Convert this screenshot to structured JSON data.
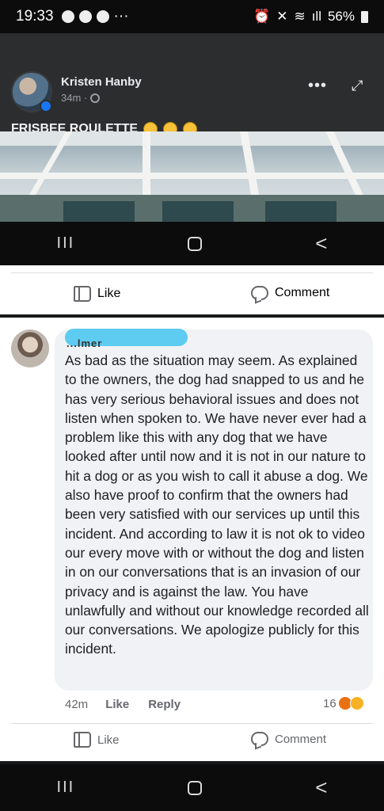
{
  "status_bar": {
    "time": "19:33",
    "extras": "···",
    "battery": "56%"
  },
  "post": {
    "author": "Kristen Hanby",
    "time": "34m ·",
    "caption": "FRISBEE ROULETTE",
    "emoji_count": 3
  },
  "video_nav": {
    "recent": "III",
    "back": "<"
  },
  "actions_top": {
    "like": "Like",
    "comment": "Comment"
  },
  "comment": {
    "author_visible_fragment": "...lmer",
    "text": "As bad as the situation may seem. As explained to the owners, the dog had snapped to us and he has very serious behavioral issues and does not listen when spoken to. We have never ever had a problem like this with any dog  that we have looked after until now and it is not in our nature to hit a dog or as you wish to call it abuse a dog. We also have proof to confirm that the owners had been very satisfied with our services up until this incident.  And according to law it is not ok to video our every move with or without the dog and listen in on our conversations that is an invasion of our privacy and is against the law. You have unlawfully and without our knowledge recorded all our conversations. We apologize publicly for this incident.",
    "time": "42m",
    "like": "Like",
    "reply": "Reply",
    "reaction_count": "16"
  },
  "actions_bottom": {
    "like": "Like",
    "comment": "Comment"
  },
  "system_nav": {
    "recent": "III",
    "back": "<"
  },
  "colors": {
    "accent_blue": "#1877f2",
    "redaction": "#5ecbf0"
  }
}
